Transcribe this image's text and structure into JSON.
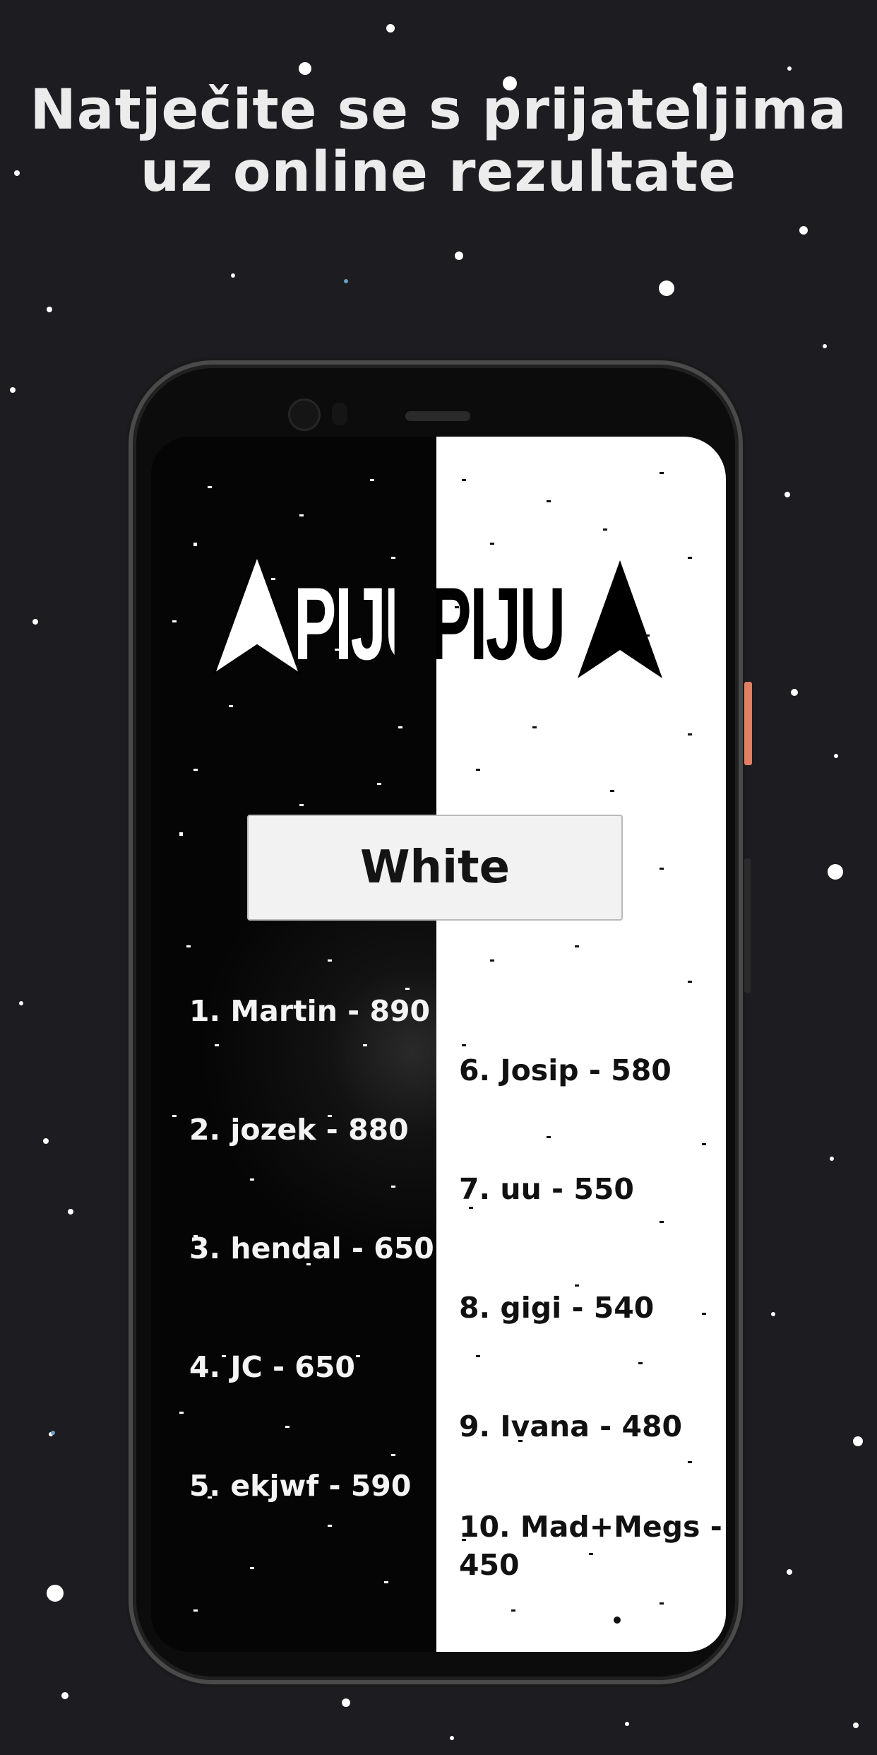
{
  "headline": {
    "line1": "Natječite se s prijateljima",
    "line2": "uz online rezultate"
  },
  "app": {
    "logo_text_white": "PIJUPIJU",
    "logo_text_black": "PIJUPIJU",
    "mode_button_label": "White",
    "colors": {
      "background": "#1d1c20",
      "screen_left": "#050505",
      "screen_right": "#ffffff",
      "button": "#f2f2f2",
      "phone_accent_button": "#e07f62"
    }
  },
  "leaderboard": {
    "left_column": [
      "1. Martin - 890",
      "2. jozek - 880",
      "3. hendal - 650",
      "4. JC - 650",
      "5. ekjwf - 590"
    ],
    "right_column": [
      "6. Josip - 580",
      "7. uu - 550",
      "8. gigi - 540",
      "9. Ivana - 480",
      "10. Mad+Megs -",
      "450"
    ]
  }
}
